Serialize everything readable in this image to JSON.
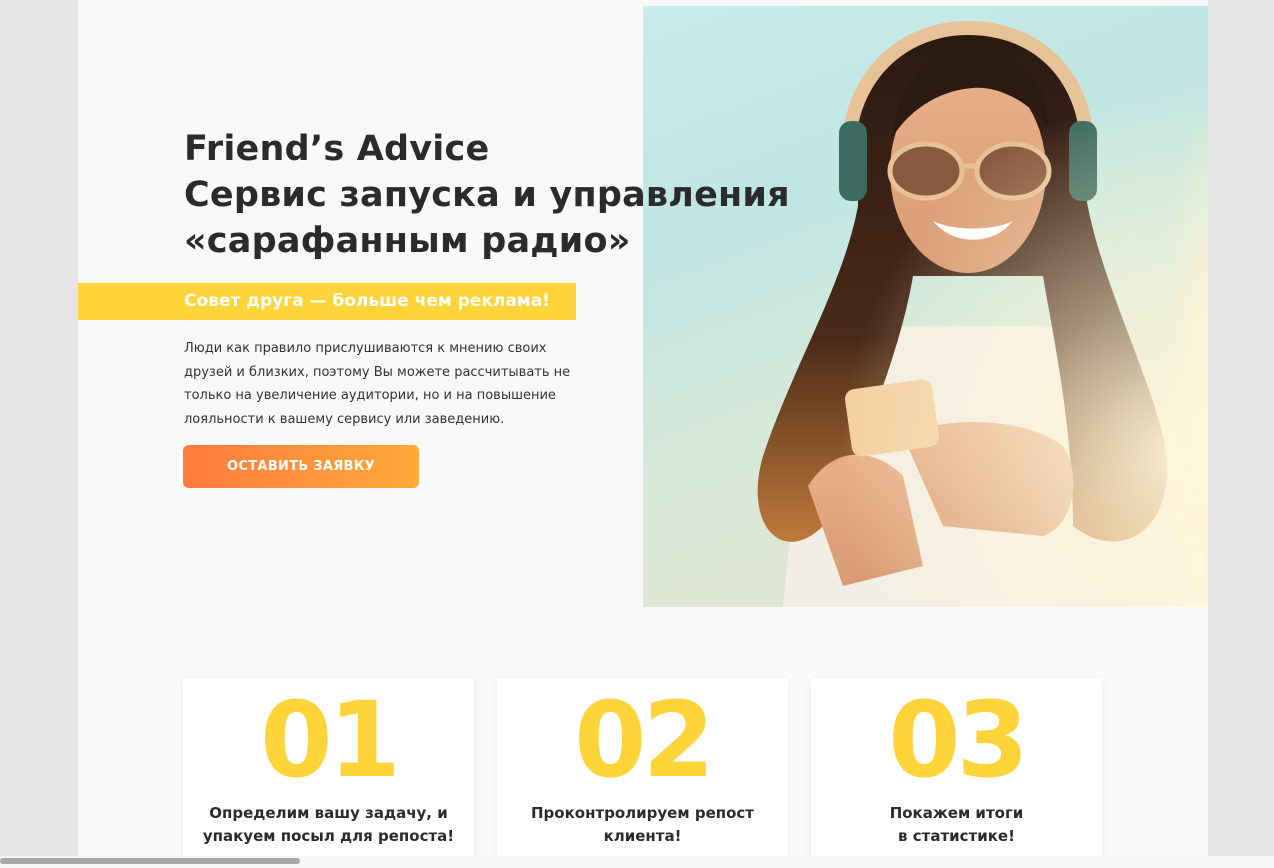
{
  "hero": {
    "title_line1": "Friend’s Advice",
    "title_line2": "Сервис запуска и управления",
    "title_line3": "«сарафанным радио»",
    "tagline": "Совет друга — больше чем реклама!",
    "description": "Люди как правило прислушиваются к мнению своих друзей и близких, поэтому Вы можете рассчитывать не только на увеличение аудитории, но и на повышение лояльности к вашему сервису или заведению.",
    "cta_label": "Оставить заявку"
  },
  "steps": [
    {
      "number": "01",
      "line1": "Определим вашу задачу, и",
      "line2": "упакуем посыл для репоста!"
    },
    {
      "number": "02",
      "line1": "Проконтролируем репост",
      "line2": "клиента!"
    },
    {
      "number": "03",
      "line1": "Покажем итоги",
      "line2": "в статистике!"
    }
  ],
  "colors": {
    "accent_yellow": "#fdd33a",
    "cta_gradient_start": "#ff7a3d",
    "cta_gradient_end": "#ffaa3a",
    "text_dark": "#2b2b2b"
  }
}
